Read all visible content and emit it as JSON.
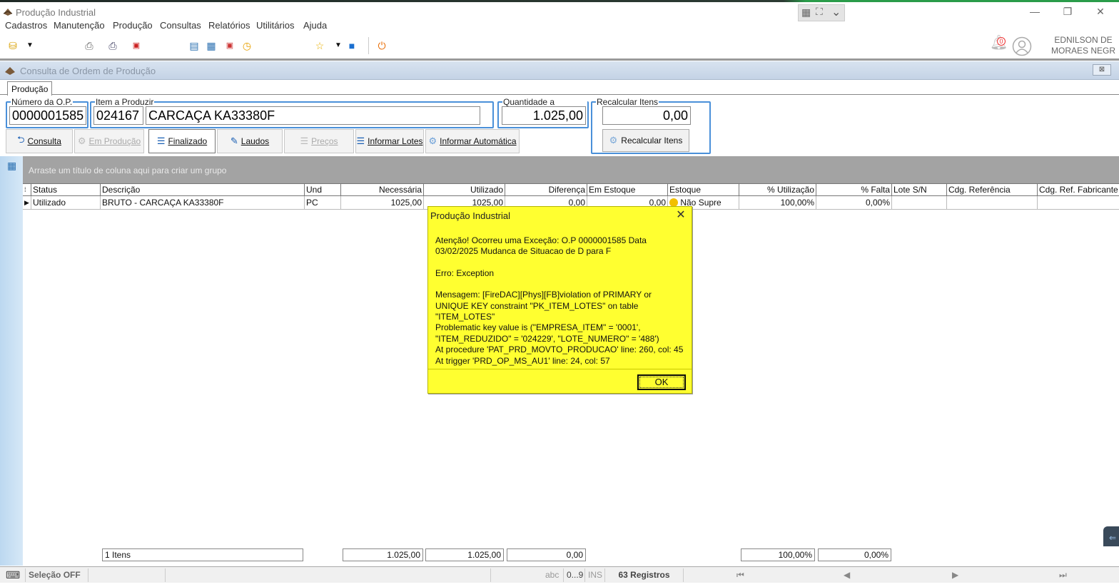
{
  "window": {
    "title": "Produção Industrial"
  },
  "menu": [
    "Cadastros",
    "Manutenção",
    "Produção",
    "Consultas",
    "Relatórios",
    "Utilitários",
    "Ajuda"
  ],
  "user": {
    "name_line1": "EDNILSON DE",
    "name_line2": "MORAES NEGR",
    "notification_count": "0"
  },
  "child_window": {
    "title": "Consulta de Ordem de Produção",
    "close": "⊠"
  },
  "tab": {
    "label": "Produção"
  },
  "fields": {
    "op_label": "Número da O.P.",
    "op_value": "0000001585",
    "item_label": "Item a Produzir",
    "item_code": "024167",
    "item_desc": "CARCAÇA KA33380F",
    "qty_label": "Quantidade a Produzir",
    "qty_value": "1.025,00",
    "recalc_label": "Recalcular Itens",
    "recalc_value": "0,00"
  },
  "buttons": {
    "consulta": "Consulta",
    "em_producao": "Em Produção",
    "finalizado": "Finalizado",
    "laudos": "Laudos",
    "precos": "Preços",
    "informar_lotes": "Informar Lotes",
    "informar_automatica": "Informar Automática",
    "recalcular_itens": "Recalcular Itens"
  },
  "grid": {
    "group_hint": "Arraste um título de coluna aqui para criar um grupo",
    "columns": [
      "Status",
      "Descrição",
      "Und",
      "Necessária",
      "Utilizado",
      "Diferença",
      "Em Estoque",
      "Estoque",
      "% Utilização",
      "% Falta",
      "Lote S/N",
      "Cdg. Referência",
      "Cdg. Ref. Fabricante"
    ],
    "rows": [
      {
        "status": "Utilizado",
        "descricao": "BRUTO - CARCAÇA KA33380F",
        "und": "PC",
        "necessaria": "1025,00",
        "utilizado": "1025,00",
        "diferenca": "0,00",
        "em_estoque": "0,00",
        "estoque": "Não Supre",
        "utilizacao": "100,00%",
        "falta": "0,00%",
        "lote": "",
        "ref": "",
        "ref_fab": ""
      }
    ],
    "footer": {
      "count": "1 Itens",
      "necessaria": "1.025,00",
      "utilizado": "1.025,00",
      "diferenca": "0,00",
      "utilizacao": "100,00%",
      "falta": "0,00%"
    }
  },
  "statusbar": {
    "selecao": "Seleção OFF",
    "abc": "abc",
    "num": "0...9",
    "ins": "INS",
    "registros": "63 Registros"
  },
  "dialog": {
    "title": "Produção Industrial",
    "close": "✕",
    "para1": "Atenção! Ocorreu uma Exceção:  O.P 0000001585 Data\n03/02/2025 Mudanca de Situacao de D para F",
    "para2": "Erro: Exception",
    "para3": " Mensagem: [FireDAC][Phys][FB]violation of PRIMARY or\nUNIQUE KEY constraint \"PK_ITEM_LOTES\" on table \"ITEM_LOTES\"\nProblematic key value is (\"EMPRESA_ITEM\" = '0001',\n\"ITEM_REDUZIDO\" = '024229', \"LOTE_NUMERO\" = '488')\nAt procedure 'PAT_PRD_MOVTO_PRODUCAO' line: 260, col: 45\nAt trigger 'PRD_OP_MS_AU1' line: 24, col: 57",
    "ok": "OK"
  },
  "colors": {
    "dialog_bg": "#ffff30",
    "group_bar": "#a3a3a3",
    "focus_border": "#4a90d9"
  }
}
